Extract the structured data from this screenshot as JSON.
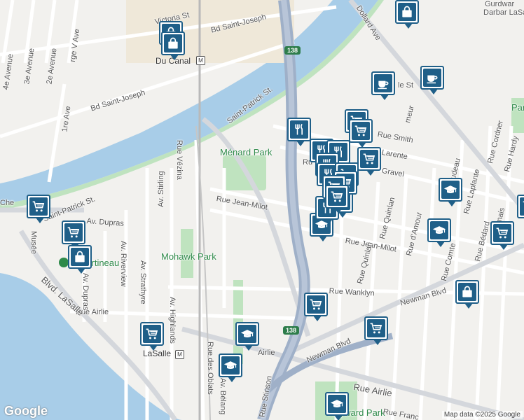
{
  "labels": {
    "victoria": "Victoria St",
    "bd_sj_top": "Bd Saint-Joseph",
    "bd_sj_left": "Bd Saint-Joseph",
    "saint_patrick": "Saint-Patrick St.",
    "saint_patrick_left": "Saint-Patrick St.",
    "chemin": "Che",
    "du_canal": "Du Canal",
    "menard": "Ménard Park",
    "mohawk": "Mohawk Park",
    "martineau": "rc Martineau",
    "hayward": "Hayward Park",
    "jean_milot": "Rue Jean-Milot",
    "jean_milot_r": "Rue Jean-Milot",
    "wanklyn": "Rue Wanklyn",
    "newman": "Newman Blvd",
    "newman2": "Newman Blvd",
    "airlie": "Rue Airlie",
    "airlie_r": "Rue Airlie",
    "airlie_mid": "Airlie",
    "smith": "Rue Smith",
    "larente": "Larente",
    "gravel": "Gravel",
    "vezina": "Rue Vézina",
    "stirling": "Av. Stirling",
    "dupras": "Av. Dupras",
    "dupras_v": "Av. Dupras",
    "riverview": "Av. Riverview",
    "strathyre": "Av. Strathyre",
    "highlands": "Av. Highlands",
    "oblats": "Rue des Oblats",
    "belanger": "Av. Bélang",
    "stinson": "Rue Stinson",
    "quinlan": "Rue Quinlan",
    "quinlan2": "Rue Quinlan",
    "damour": "Rue d'Amour",
    "comte": "Rue Comte",
    "bedard": "Rue Bédard",
    "laplante": "Rue Laplante",
    "cordner": "Rue Cordner",
    "hardy": "Rue Hardy",
    "rudeau": "rudeau",
    "mais": "mais",
    "dollard": "Dollard Ave",
    "meur": "meur",
    "le_st": "le St",
    "ave1": "1re Ave",
    "ave2": "2e Avenue",
    "ave3": "3e Avenue",
    "ave4": "4e Avenue",
    "rge": "rge V Ave",
    "lasalle_blvd": "Blvd. LaSalle",
    "lasalle_station": "LaSalle",
    "musee": "Musée",
    "francs": "Rue Franc",
    "r_short": "Ru",
    "park_r": "Par",
    "gurdwara": "Gurdwar",
    "darbar": "Darbar LaSal"
  },
  "highway": "138",
  "highway2": "138",
  "footer": {
    "google": "Google",
    "attribution": "Map data ©2025 Google"
  },
  "icon_names": [
    "cart-icon",
    "bag-icon",
    "fork-knife-icon",
    "cup-icon",
    "graduation-cap-icon"
  ],
  "colors": {
    "water": "#a8cde8",
    "pin": "#1f5f88",
    "park": "#bfe3bf",
    "highway": "#9fb0c8"
  }
}
